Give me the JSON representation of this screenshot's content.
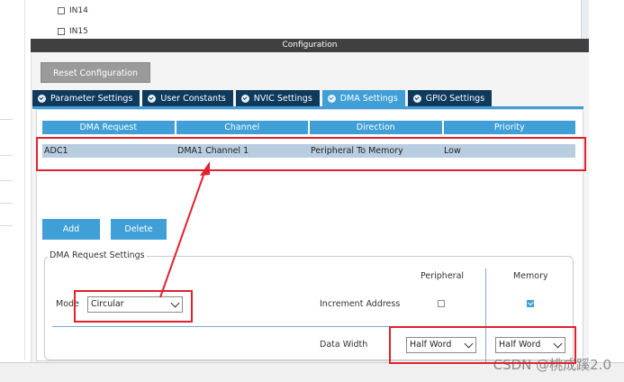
{
  "pin_list": {
    "items": [
      "IN14",
      "IN15"
    ]
  },
  "configuration": {
    "title": "Configuration",
    "reset_label": "Reset Configuration"
  },
  "tabs": [
    {
      "label": "Parameter Settings"
    },
    {
      "label": "User Constants"
    },
    {
      "label": "NVIC Settings"
    },
    {
      "label": "DMA Settings"
    },
    {
      "label": "GPIO Settings"
    }
  ],
  "dma_table": {
    "headers": [
      "DMA Request",
      "Channel",
      "Direction",
      "Priority"
    ],
    "rows": [
      [
        "ADC1",
        "DMA1 Channel 1",
        "Peripheral To Memory",
        "Low"
      ]
    ]
  },
  "buttons": {
    "add": "Add",
    "delete": "Delete"
  },
  "request_settings": {
    "legend": "DMA Request Settings",
    "mode_label": "Mode",
    "mode_value": "Circular",
    "peripheral_header": "Peripheral",
    "memory_header": "Memory",
    "increment_label": "Increment Address",
    "data_width_label": "Data Width",
    "peripheral_width": "Half Word",
    "memory_width": "Half Word"
  },
  "watermark": "CSDN @桃成蹊2.0",
  "colors": {
    "accent": "#3f9fd6",
    "tab_dark": "#0f3a5c",
    "annotation": "#e0222e"
  }
}
